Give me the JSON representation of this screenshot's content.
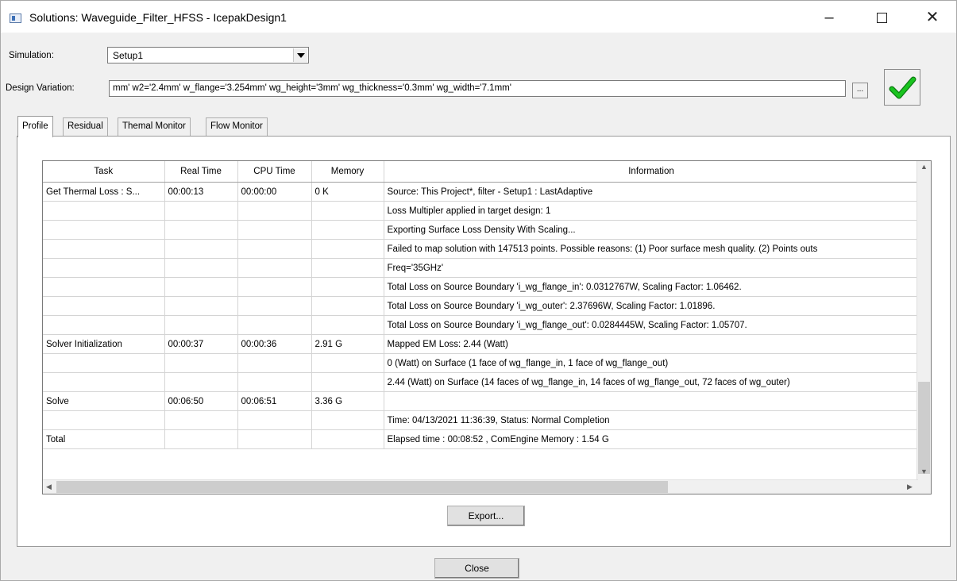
{
  "window": {
    "title": "Solutions: Waveguide_Filter_HFSS - IcepakDesign1",
    "minimize_glyph": "–",
    "close_glyph": "✕"
  },
  "simulation": {
    "label": "Simulation:",
    "value": "Setup1"
  },
  "design_variation": {
    "label": "Design Variation:",
    "value": "mm' w2='2.4mm' w_flange='3.254mm' wg_height='3mm' wg_thickness='0.3mm' wg_width='7.1mm'",
    "browse_label": "..."
  },
  "tabs": [
    {
      "label": "Profile",
      "active": true
    },
    {
      "label": "Residual",
      "active": false
    },
    {
      "label": "Themal Monitor",
      "active": false
    },
    {
      "label": "Flow Monitor",
      "active": false
    }
  ],
  "table": {
    "columns": [
      "Task",
      "Real Time",
      "CPU Time",
      "Memory",
      "Information"
    ],
    "rows": [
      [
        "Get Thermal Loss : S...",
        "00:00:13",
        "00:00:00",
        "0 K",
        "Source: This Project*, filter - Setup1 : LastAdaptive"
      ],
      [
        "",
        "",
        "",
        "",
        "Loss Multipler applied in target design: 1"
      ],
      [
        "",
        "",
        "",
        "",
        "Exporting Surface Loss Density With Scaling..."
      ],
      [
        "",
        "",
        "",
        "",
        "Failed to map solution with 147513 points. Possible reasons: (1) Poor surface mesh quality. (2) Points outs"
      ],
      [
        "",
        "",
        "",
        "",
        "Freq='35GHz'"
      ],
      [
        "",
        "",
        "",
        "",
        "Total Loss on Source Boundary 'i_wg_flange_in': 0.0312767W, Scaling Factor: 1.06462."
      ],
      [
        "",
        "",
        "",
        "",
        "Total Loss on Source Boundary 'i_wg_outer': 2.37696W, Scaling Factor: 1.01896."
      ],
      [
        "",
        "",
        "",
        "",
        "Total Loss on Source Boundary 'i_wg_flange_out': 0.0284445W, Scaling Factor: 1.05707."
      ],
      [
        "Solver Initialization",
        "00:00:37",
        "00:00:36",
        "2.91 G",
        "Mapped EM Loss: 2.44 (Watt)"
      ],
      [
        "",
        "",
        "",
        "",
        "0 (Watt) on Surface (1 face of wg_flange_in, 1 face of wg_flange_out)"
      ],
      [
        "",
        "",
        "",
        "",
        "2.44 (Watt) on Surface (14 faces of wg_flange_in, 14 faces of wg_flange_out, 72 faces of wg_outer)"
      ],
      [
        "Solve",
        "00:06:50",
        "00:06:51",
        "3.36 G",
        ""
      ],
      [
        "",
        "",
        "",
        "",
        "Time:  04/13/2021 11:36:39, Status: Normal Completion"
      ],
      [
        "Total",
        "",
        "",
        "",
        "Elapsed time : 00:08:52 , ComEngine Memory : 1.54 G"
      ]
    ]
  },
  "buttons": {
    "export": "Export...",
    "close": "Close"
  },
  "colors": {
    "check_green": "#19c41f",
    "window_bg": "#f0f0f0"
  }
}
